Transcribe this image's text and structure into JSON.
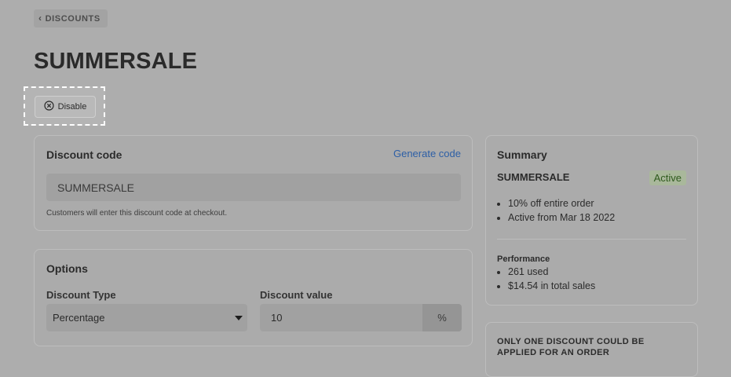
{
  "breadcrumb": {
    "label": "DISCOUNTS"
  },
  "page": {
    "title": "SUMMERSALE"
  },
  "actions": {
    "disable_label": "Disable"
  },
  "discount_code_card": {
    "title": "Discount code",
    "generate_label": "Generate code",
    "code_value": "SUMMERSALE",
    "helper_text": "Customers will enter this discount code at checkout."
  },
  "options_card": {
    "title": "Options",
    "type_label": "Discount Type",
    "type_value": "Percentage",
    "value_label": "Discount value",
    "value": "10",
    "value_suffix": "%"
  },
  "summary_card": {
    "title": "Summary",
    "code": "SUMMERSALE",
    "status": "Active",
    "details": [
      "10% off entire order",
      "Active from Mar 18 2022"
    ],
    "performance_label": "Performance",
    "performance": [
      "261 used",
      "$14.54 in total sales"
    ]
  },
  "notice_card": {
    "text": "ONLY ONE DISCOUNT COULD BE APPLIED FOR AN ORDER"
  },
  "colors": {
    "link": "#2d5fa6",
    "status_bg": "#a9b89b",
    "status_text": "#2f5a1d"
  }
}
